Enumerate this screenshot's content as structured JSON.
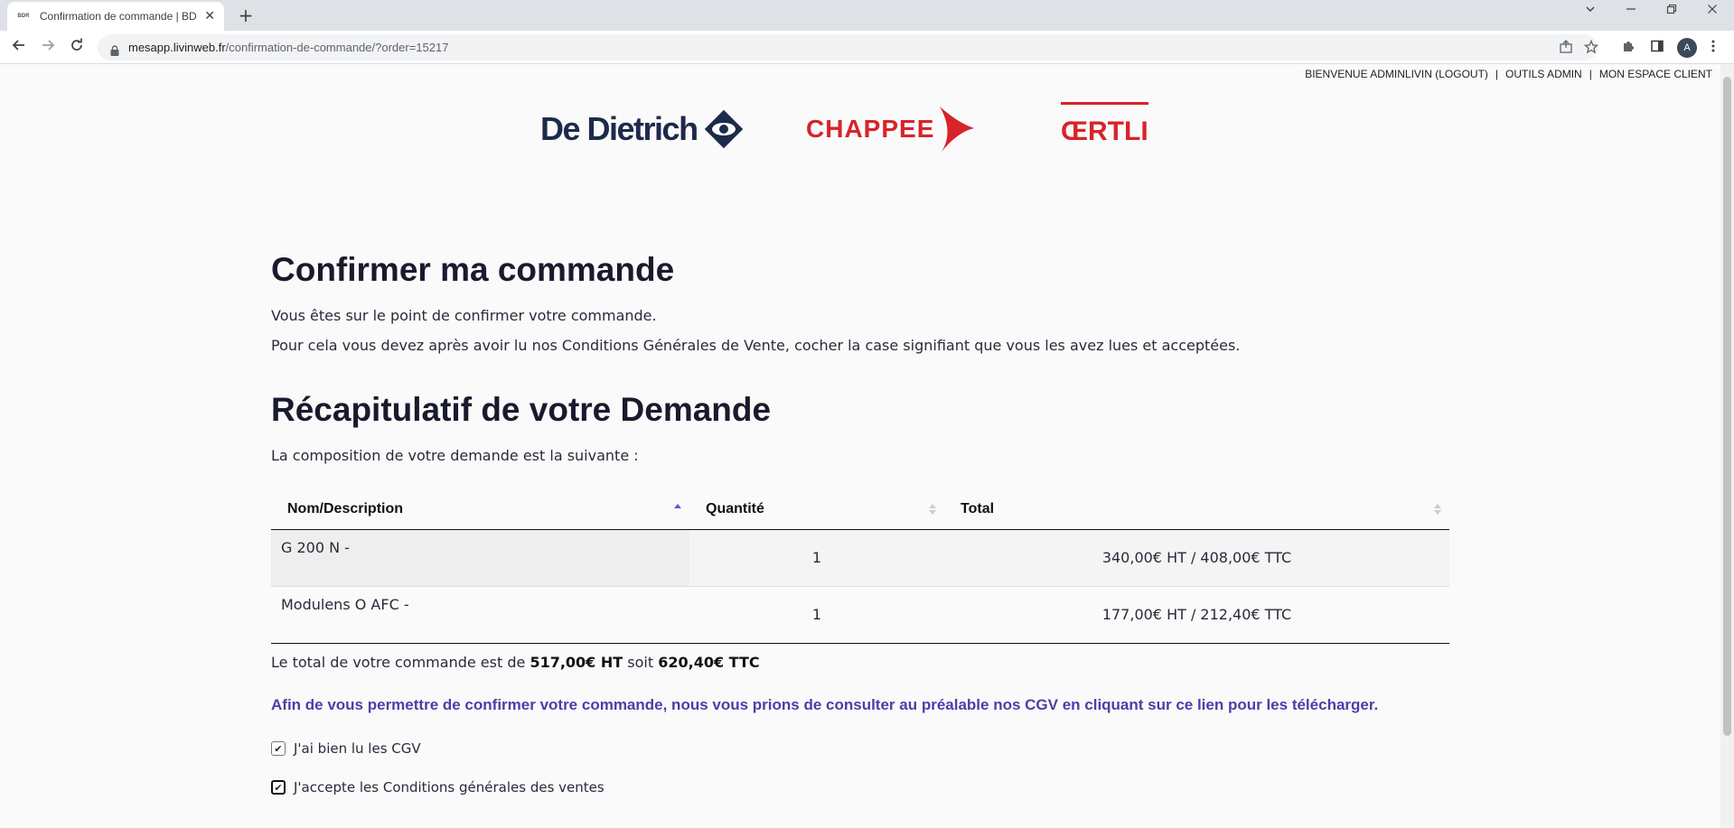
{
  "browser": {
    "tab_favicon": "BDR",
    "tab_title": "Confirmation de commande | BDR",
    "tab_close": "✕",
    "new_tab": "+",
    "url_host": "mesapp.livinweb.fr",
    "url_path": "/confirmation-de-commande/?order=15217",
    "profile_initial": "A"
  },
  "topnav": {
    "welcome": "BIENVENUE ADMINLIVIN (LOGOUT)",
    "separator": "|",
    "admin_tools": "OUTILS ADMIN",
    "client_space": "MON ESPACE CLIENT"
  },
  "brands": {
    "de_dietrich": "De Dietrich",
    "chappee": "CHAPPEE",
    "oertli": "ŒRTLI"
  },
  "confirm": {
    "title": "Confirmer ma commande",
    "line1": "Vous êtes sur le point de confirmer votre commande.",
    "line2": "Pour cela vous devez après avoir lu nos Conditions Générales de Vente, cocher la case signifiant que vous les avez lues et acceptées."
  },
  "summary": {
    "title": "Récapitulatif de votre Demande",
    "intro": "La composition de votre demande est la suivante :",
    "columns": [
      "Nom/Description",
      "Quantité",
      "Total"
    ],
    "rows": [
      {
        "name": "G 200 N -",
        "qty": "1",
        "total": "340,00€ HT / 408,00€ TTC"
      },
      {
        "name": "Modulens O AFC -",
        "qty": "1",
        "total": "177,00€ HT / 212,40€ TTC"
      }
    ]
  },
  "total": {
    "prefix": "Le total de votre commande est de",
    "ht": "517,00€ HT",
    "middle": "soit",
    "ttc": "620,40€ TTC"
  },
  "cgv": {
    "link_text": "Afin de vous permettre de confirmer votre commande, nous vous prions de consulter au préalable nos CGV en cliquant sur ce lien pour les télécharger.",
    "checkbox_read": "J'ai bien lu les CGV",
    "checkbox_accept": "J'accepte les Conditions générales des ventes",
    "check_mark": "✔"
  },
  "colors": {
    "brand_navy": "#1e2a4a",
    "brand_red": "#d8232a",
    "link_purple": "#4a3fa8"
  }
}
